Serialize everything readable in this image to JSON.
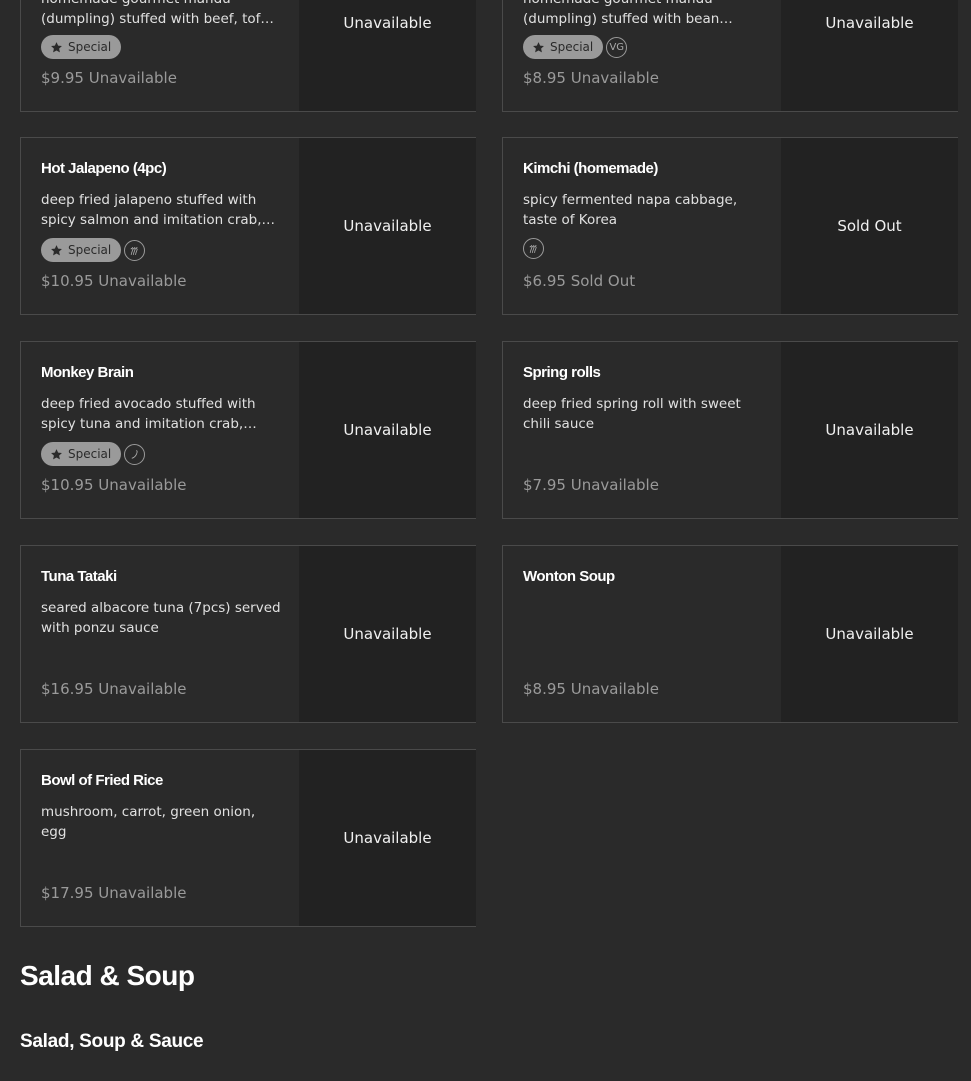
{
  "items": [
    {
      "name": "",
      "description": "homemade gourmet mandu (dumpling) stuffed with beef, tofu, vegetables",
      "special": "Special",
      "diet": [],
      "price": "$9.95",
      "price_status": "Unavailable",
      "status": "Unavailable"
    },
    {
      "name": "",
      "description": "homemade gourmet mandu (dumpling) stuffed with bean noodles, vegetables",
      "special": "Special",
      "diet": [
        "VG"
      ],
      "price": "$8.95",
      "price_status": "Unavailable",
      "status": "Unavailable"
    },
    {
      "name": "Hot Jalapeno (4pc)",
      "description": "deep fried jalapeno stuffed with spicy salmon and imitation crab, cream cheese",
      "special": "Special",
      "diet": [
        "spicy-icon"
      ],
      "price": "$10.95",
      "price_status": "Unavailable",
      "status": "Unavailable"
    },
    {
      "name": "Kimchi (homemade)",
      "description": "spicy fermented napa cabbage, taste of Korea",
      "special": "",
      "diet": [
        "spicy-icon"
      ],
      "price": "$6.95",
      "price_status": "Sold Out",
      "status": "Sold Out"
    },
    {
      "name": "Monkey Brain",
      "description": "deep fried avocado stuffed with spicy tuna and imitation crab, cream cheese",
      "special": "Special",
      "diet": [
        "chili-icon"
      ],
      "price": "$10.95",
      "price_status": "Unavailable",
      "status": "Unavailable"
    },
    {
      "name": "Spring rolls",
      "description": "deep fried spring roll with sweet chili sauce",
      "special": "",
      "diet": [],
      "price": "$7.95",
      "price_status": "Unavailable",
      "status": "Unavailable"
    },
    {
      "name": "Tuna Tataki",
      "description": "seared albacore tuna (7pcs) served with ponzu sauce",
      "special": "",
      "diet": [],
      "price": "$16.95",
      "price_status": "Unavailable",
      "status": "Unavailable"
    },
    {
      "name": "Wonton Soup",
      "description": "",
      "special": "",
      "diet": [],
      "price": "$8.95",
      "price_status": "Unavailable",
      "status": "Unavailable"
    },
    {
      "name": "Bowl of Fried Rice",
      "description": "mushroom, carrot, green onion, egg",
      "special": "",
      "diet": [],
      "price": "$17.95",
      "price_status": "Unavailable",
      "status": "Unavailable"
    }
  ],
  "section": {
    "title": "Salad & Soup",
    "subtitle": "Salad, Soup & Sauce"
  }
}
